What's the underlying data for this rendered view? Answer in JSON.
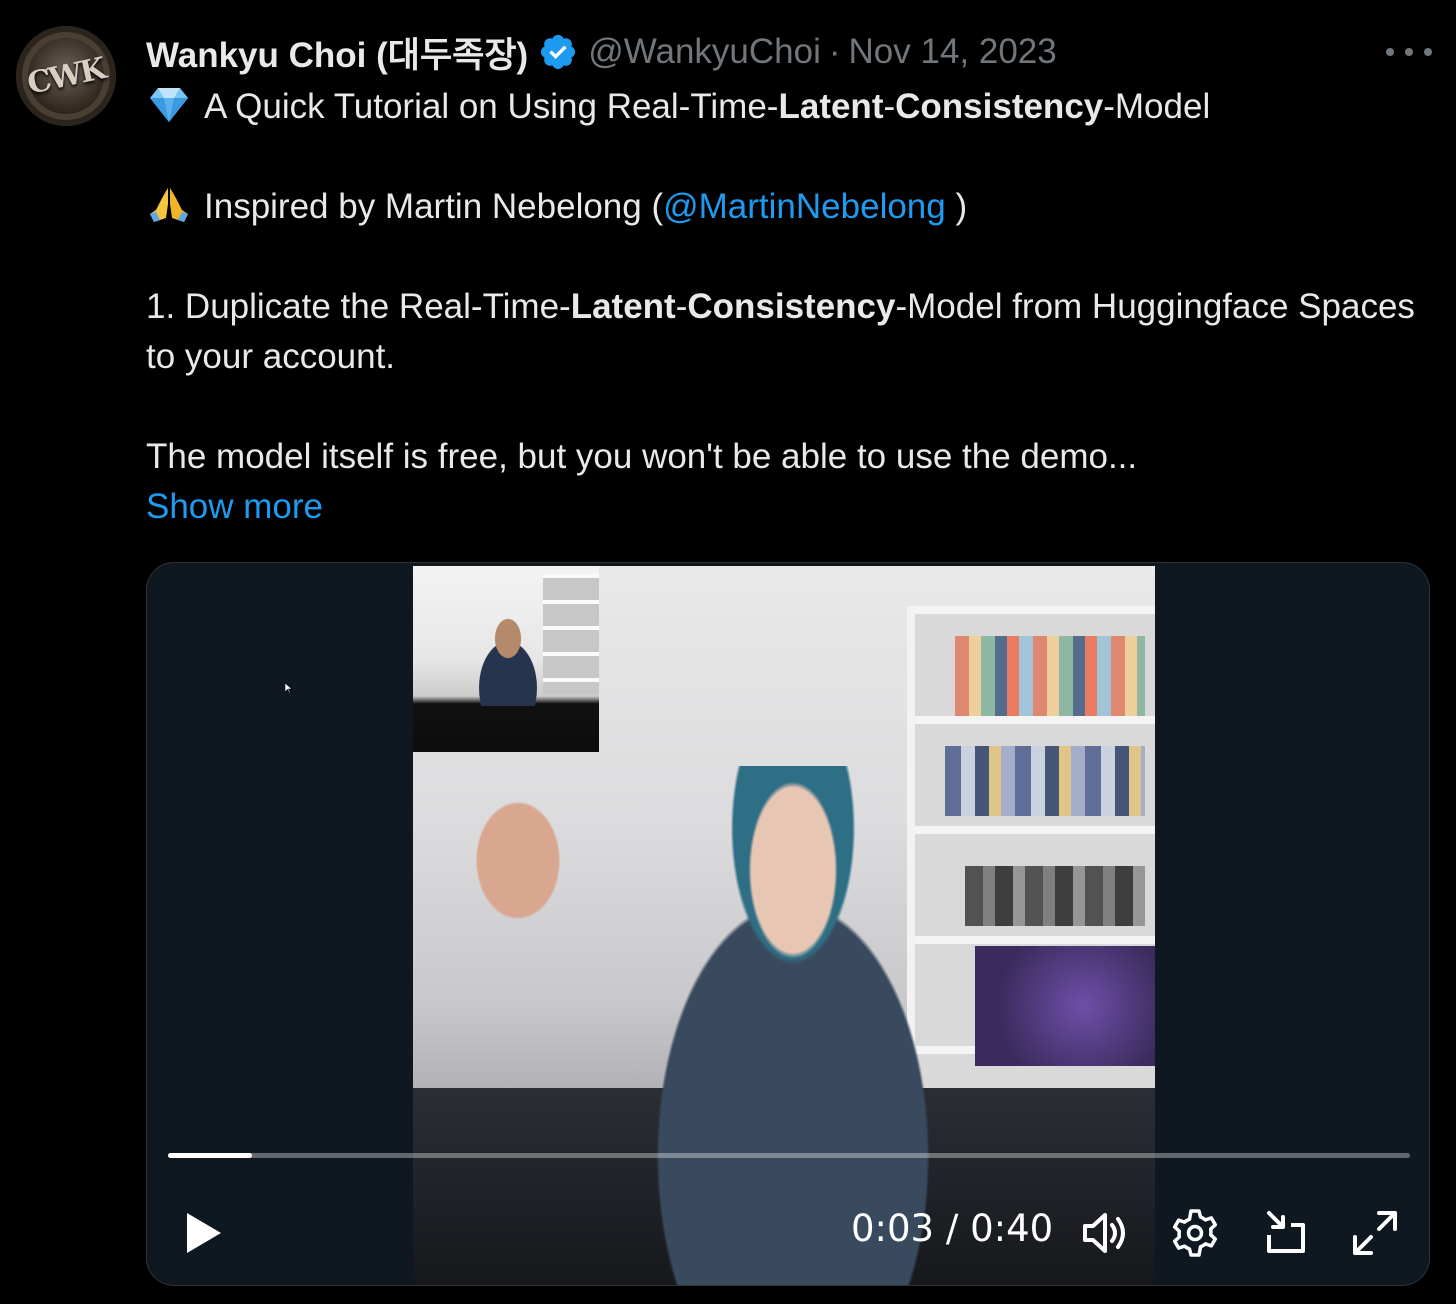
{
  "tweet": {
    "author_name": "Wankyu Choi (대두족장)",
    "handle": "@WankyuChoi",
    "separator": "·",
    "date": "Nov 14, 2023",
    "avatar_monogram": "CWK",
    "line1": {
      "prefix": "A Quick Tutorial on Using Real-Time-",
      "bold1": "Latent",
      "mid": "-",
      "bold2": "Consistency",
      "suffix": "-Model"
    },
    "line2": {
      "prefix": "Inspired by Martin Nebelong (",
      "mention": "@MartinNebelong",
      "suffix": " )"
    },
    "line3": {
      "prefix": "1. Duplicate the Real-Time-",
      "bold1": "Latent",
      "mid": "-",
      "bold2": "Consistency",
      "suffix": "-Model from Huggingface Spaces to your account."
    },
    "line4": "The model itself is free, but you won't be able to use the demo...",
    "show_more": "Show more"
  },
  "video": {
    "current_time": "0:03",
    "time_separator": " / ",
    "duration": "0:40",
    "progress_fraction": 0.068
  },
  "icons": {
    "verified": "verified-badge-icon",
    "more": "more-options-icon",
    "diamond": "gem-emoji-icon",
    "praying": "folded-hands-emoji-icon",
    "play": "play-icon",
    "volume": "volume-icon",
    "settings": "gear-icon",
    "dock": "minimize-to-corner-icon",
    "fullscreen": "fullscreen-icon"
  },
  "colors": {
    "background": "#000000",
    "text": "#e7e9ea",
    "muted": "#71767b",
    "link": "#1d9bf0",
    "verified": "#1d9bf0"
  }
}
